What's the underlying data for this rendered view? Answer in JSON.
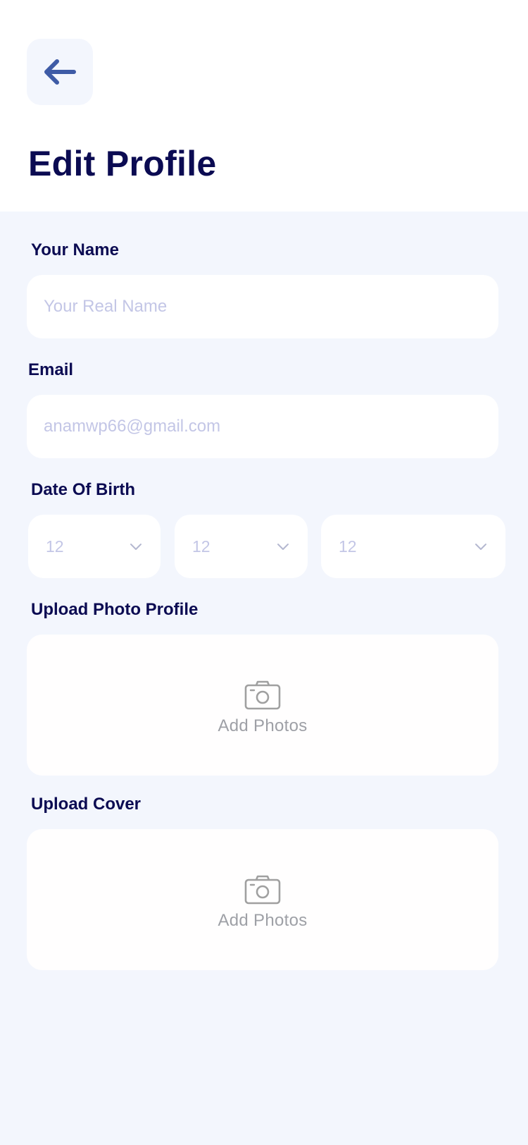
{
  "header": {
    "title": "Edit Profile",
    "back_icon": "arrow-left-icon"
  },
  "form": {
    "name": {
      "label": "Your Name",
      "placeholder": "Your Real Name",
      "value": ""
    },
    "email": {
      "label": "Email",
      "placeholder": "anamwp66@gmail.com",
      "value": ""
    },
    "dob": {
      "label": "Date Of Birth",
      "day": "12",
      "month": "12",
      "year": "12"
    },
    "photo_profile": {
      "label": "Upload Photo Profile",
      "action": "Add Photos"
    },
    "cover": {
      "label": "Upload Cover",
      "action": "Add Photos"
    }
  },
  "colors": {
    "title": "#0B0B52",
    "accent": "#3E5BA6",
    "background": "#F3F6FD",
    "placeholder": "#C3C6E6",
    "muted": "#9EA0A6"
  }
}
